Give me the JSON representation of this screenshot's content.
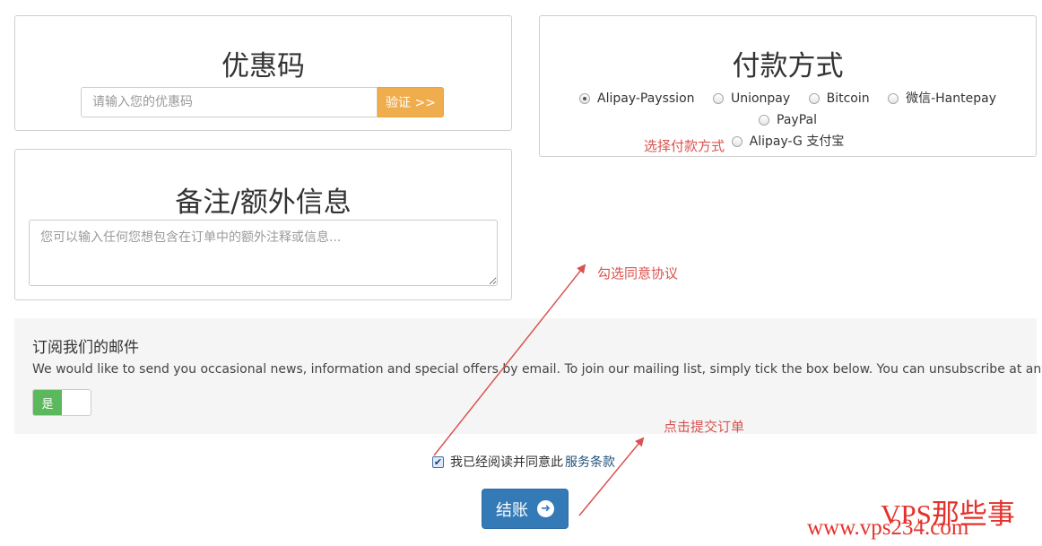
{
  "promo": {
    "title": "优惠码",
    "input_placeholder": "请输入您的优惠码",
    "validate_label": "验证 >>"
  },
  "payment": {
    "title": "付款方式",
    "options": [
      {
        "label": "Alipay-Payssion",
        "selected": true
      },
      {
        "label": "Unionpay",
        "selected": false
      },
      {
        "label": "Bitcoin",
        "selected": false
      },
      {
        "label": "微信-Hantepay",
        "selected": false
      },
      {
        "label": "PayPal",
        "selected": false
      },
      {
        "label": "Alipay-G 支付宝",
        "selected": false
      }
    ]
  },
  "notes": {
    "title": "备注/额外信息",
    "placeholder": "您可以输入任何您想包含在订单中的额外注释或信息..."
  },
  "newsletter": {
    "title": "订阅我们的邮件",
    "text": "We would like to send you occasional news, information and special offers by email. To join our mailing list, simply tick the box below. You can unsubscribe at any time.",
    "toggle_label": "是",
    "toggle_on": true
  },
  "terms": {
    "checked": true,
    "text": "我已经阅读并同意此",
    "link_label": "服务条款"
  },
  "checkout": {
    "label": "结账"
  },
  "annotations": {
    "payment_hint": "选择付款方式",
    "agree_hint": "勾选同意协议",
    "submit_hint": "点击提交订单",
    "color": "#d9534f"
  },
  "watermark": {
    "brand": "VPS那些事",
    "url": "www.vps234.com"
  },
  "colors": {
    "primary": "#337ab7",
    "warning": "#f0ad4e",
    "success": "#5cb85c"
  }
}
